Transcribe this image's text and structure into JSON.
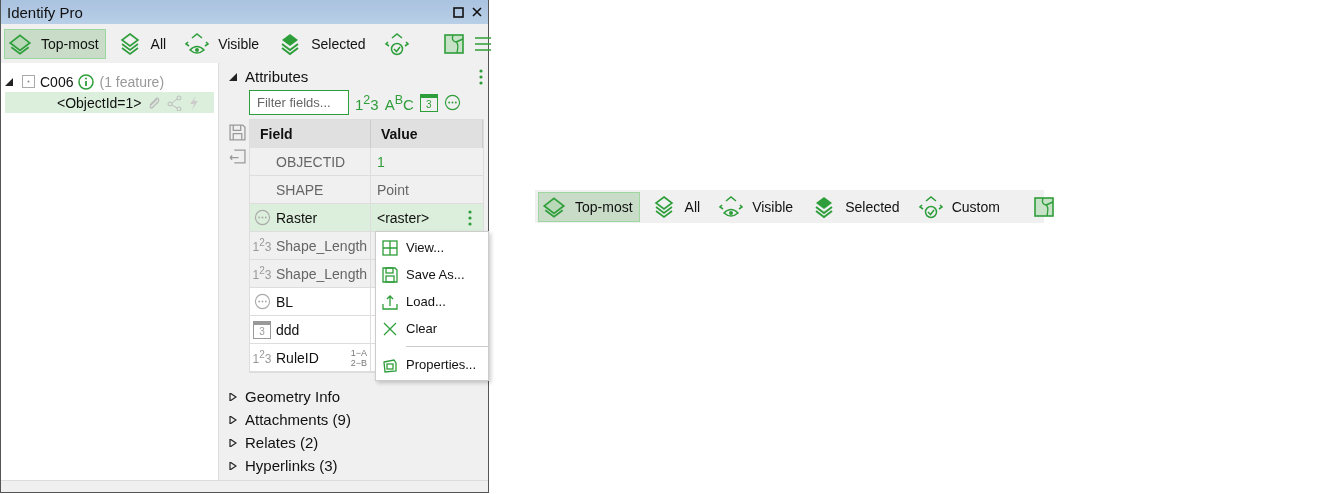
{
  "window": {
    "title": "Identify Pro"
  },
  "toolbar": {
    "buttons": [
      {
        "kind": "topmost",
        "label": "Top-most",
        "selected": true
      },
      {
        "kind": "all",
        "label": "All",
        "selected": false
      },
      {
        "kind": "visible",
        "label": "Visible",
        "selected": false
      },
      {
        "kind": "selected",
        "label": "Selected",
        "selected": false
      },
      {
        "kind": "custom",
        "selected": false
      }
    ]
  },
  "tree": [
    {
      "label": "C006",
      "note": "(1 feature)",
      "expanded": true,
      "children": [
        {
          "label": "<ObjectId=1>",
          "selected": true
        }
      ]
    }
  ],
  "attributes": {
    "title": "Attributes",
    "expanded": true,
    "filter": {
      "placeholder": "Filter fields..."
    },
    "filter_types": [
      {
        "kind": "number",
        "label": "1$^{2}$3"
      },
      {
        "kind": "text",
        "label": "A$^{B}$C"
      },
      {
        "kind": "date",
        "label": "3"
      },
      {
        "kind": "other"
      }
    ],
    "columns": [
      "Field",
      "Value"
    ],
    "rows": [
      {
        "kind": "none",
        "field": "OBJECTID",
        "value": "1",
        "readonly": true,
        "selected": false,
        "accent": true
      },
      {
        "kind": "none",
        "field": "SHAPE",
        "value": "Point",
        "readonly": true,
        "selected": false
      },
      {
        "kind": "other",
        "field": "Raster",
        "value": "<raster>",
        "readonly": false,
        "selected": true
      },
      {
        "kind": "number",
        "type_label": "1$^{2}$3",
        "field": "Shape_Length",
        "readonly": true,
        "selected": false
      },
      {
        "kind": "number",
        "type_label": "1$^{2}$3",
        "field": "Shape_Length",
        "readonly": true,
        "selected": false
      },
      {
        "kind": "other",
        "field": "BL",
        "readonly": false,
        "selected": false
      },
      {
        "kind": "date",
        "type_label": "3",
        "field": "ddd",
        "readonly": false,
        "selected": false
      },
      {
        "kind": "number",
        "type_label": "1$^{2}$3",
        "field": "RuleID",
        "codes": [
          "1−A",
          "2−B"
        ],
        "readonly": false,
        "selected": false
      }
    ]
  },
  "context_menu": [
    {
      "kind": "view",
      "label": "View..."
    },
    {
      "kind": "save",
      "label": "Save As..."
    },
    {
      "kind": "load",
      "label": "Load..."
    },
    {
      "kind": "clear",
      "label": "Clear"
    },
    {
      "kind": "separator"
    },
    {
      "kind": "properties",
      "label": "Properties..."
    }
  ],
  "sections": [
    {
      "title": "Geometry Info",
      "expanded": false
    },
    {
      "title": "Attachments (9)",
      "expanded": false
    },
    {
      "title": "Relates (2)",
      "expanded": false
    },
    {
      "title": "Hyperlinks (3)",
      "expanded": false
    }
  ],
  "floating_toolbar": {
    "buttons": [
      {
        "kind": "topmost",
        "label": "Top-most",
        "selected": true
      },
      {
        "kind": "all",
        "label": "All",
        "selected": false
      },
      {
        "kind": "visible",
        "label": "Visible",
        "selected": false
      },
      {
        "kind": "selected",
        "label": "Selected",
        "selected": false
      },
      {
        "kind": "custom",
        "label": "Custom",
        "selected": false
      }
    ]
  }
}
